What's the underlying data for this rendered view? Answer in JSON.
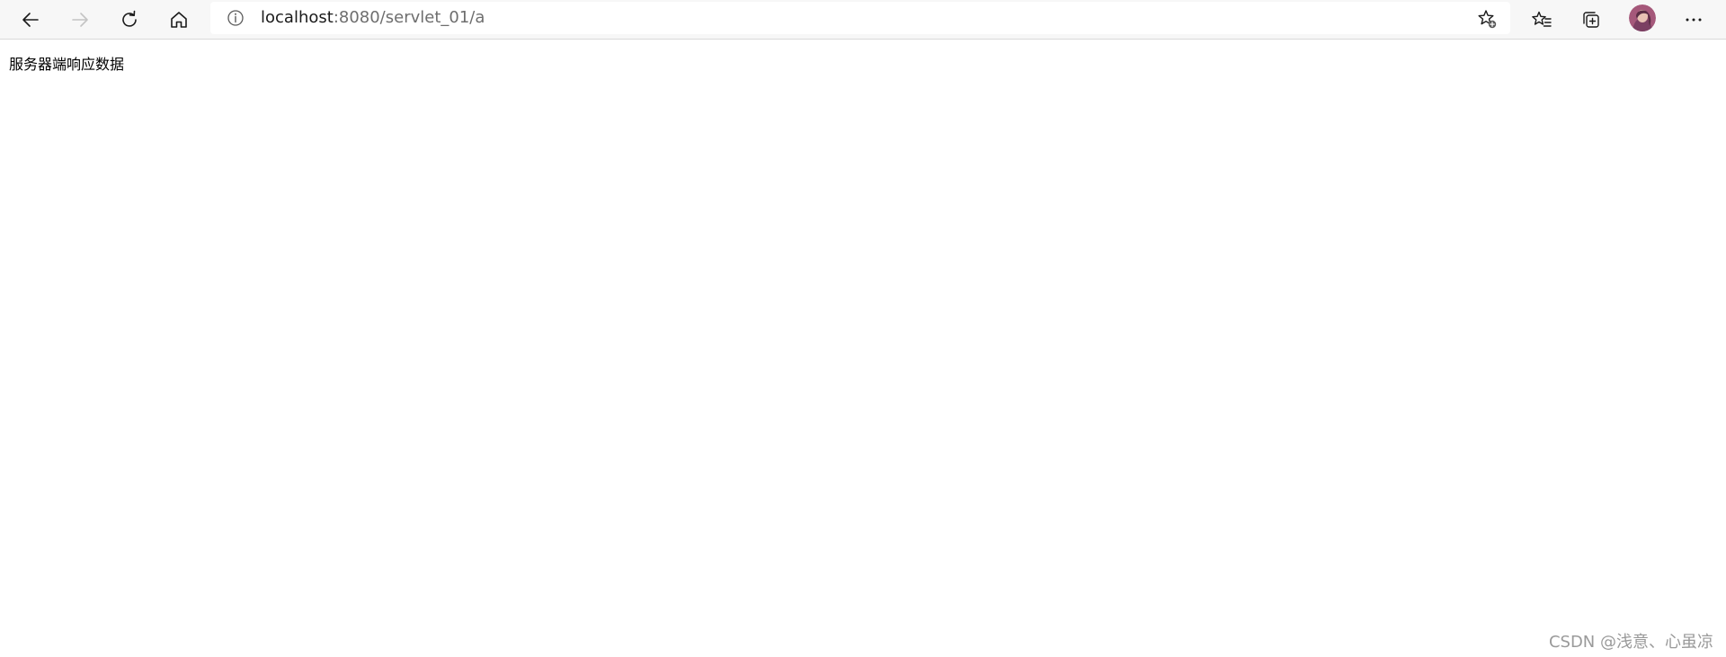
{
  "browser": {
    "url_host": "localhost",
    "url_path": ":8080/servlet_01/a",
    "icons": {
      "back": "back-arrow-icon",
      "forward": "forward-arrow-icon",
      "refresh": "refresh-icon",
      "home": "home-icon",
      "info": "info-icon",
      "add_favorite": "add-favorite-icon",
      "favorites": "favorites-icon",
      "collections": "collections-icon",
      "profile": "avatar",
      "more": "more-menu-icon"
    }
  },
  "page": {
    "body_text": "服务器端响应数据"
  },
  "watermark": {
    "text": "CSDN @浅意、心虽凉"
  }
}
